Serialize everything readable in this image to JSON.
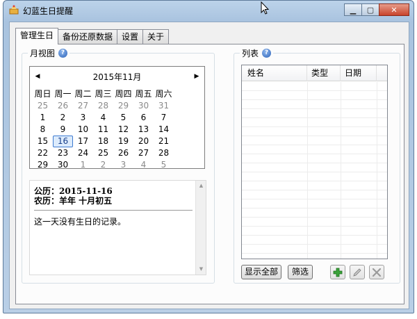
{
  "window": {
    "title": "幻蓝生日提醒"
  },
  "tabs": [
    {
      "label": "管理生日",
      "active": true
    },
    {
      "label": "备份还原数据",
      "active": false
    },
    {
      "label": "设置",
      "active": false
    },
    {
      "label": "关于",
      "active": false
    }
  ],
  "month_view": {
    "title": "月视图",
    "calendar": {
      "month_label": "2015年11月",
      "weekdays": [
        "周日",
        "周一",
        "周二",
        "周三",
        "周四",
        "周五",
        "周六"
      ],
      "dates": [
        [
          "25",
          "26",
          "27",
          "28",
          "29",
          "30",
          "31"
        ],
        [
          "1",
          "2",
          "3",
          "4",
          "5",
          "6",
          "7"
        ],
        [
          "8",
          "9",
          "10",
          "11",
          "12",
          "13",
          "14"
        ],
        [
          "15",
          "16",
          "17",
          "18",
          "19",
          "20",
          "21"
        ],
        [
          "22",
          "23",
          "24",
          "25",
          "26",
          "27",
          "28"
        ],
        [
          "29",
          "30",
          "1",
          "2",
          "3",
          "4",
          "5"
        ]
      ],
      "selected_date": "16"
    },
    "info": {
      "solar": "公历：2015-11-16",
      "lunar": "农历：羊年  十月初五",
      "note": "这一天没有生日的记录。"
    }
  },
  "list": {
    "title": "列表",
    "columns": [
      "姓名",
      "类型",
      "日期"
    ],
    "rows": [],
    "buttons": {
      "show_all": "显示全部",
      "filter": "筛选"
    }
  },
  "colors": {
    "selected_border": "#3d7bd1",
    "add_green": "#3aa23a"
  }
}
